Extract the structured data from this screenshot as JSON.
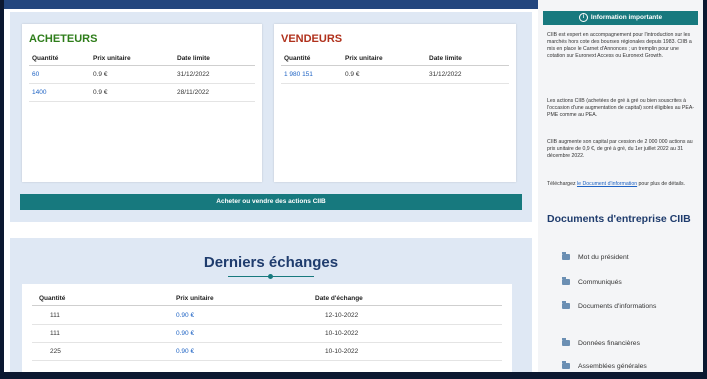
{
  "buyers": {
    "title": "ACHETEURS",
    "headers": [
      "Quantité",
      "Prix unitaire",
      "Date limite"
    ],
    "rows": [
      {
        "q": "60",
        "p": "0.9 €",
        "d": "31/12/2022"
      },
      {
        "q": "1400",
        "p": "0.9 €",
        "d": "28/11/2022"
      }
    ]
  },
  "sellers": {
    "title": "VENDEURS",
    "headers": [
      "Quantité",
      "Prix unitaire",
      "Date limite"
    ],
    "rows": [
      {
        "q": "1 980 151",
        "p": "0.9 €",
        "d": "31/12/2022"
      }
    ]
  },
  "trade_button": "Acheter ou vendre des actions CIIB",
  "exchanges": {
    "title": "Derniers échanges",
    "headers": [
      "Quantité",
      "Prix unitaire",
      "Date d'échange"
    ],
    "rows": [
      {
        "q": "111",
        "p": "0.90 €",
        "d": "12-10-2022"
      },
      {
        "q": "111",
        "p": "0.90 €",
        "d": "10-10-2022"
      },
      {
        "q": "225",
        "p": "0.90 €",
        "d": "10-10-2022"
      }
    ]
  },
  "sidebar": {
    "info_button": "Information importante",
    "p1": "CIIB est expert en accompagnement pour l'introduction sur les marchés hors cote des bourses régionales depuis 1983. CIIB a mis en place le Carnet d'Annonces ; un tremplin pour une cotation sur Euronext Access ou Euronext Growth.",
    "p2": "Les actions CIIB (achetées de gré à gré ou bien souscrites à l'occasion d'une augmentation de capital) sont éligibles au PEA-PME comme au PEA.",
    "p3": "CIIB augmente son capital par cession de 2 000 000 actions au prix unitaire de 0,9 €, de gré à gré, du 1er juillet 2022 au 31 décembre 2022.",
    "p4_prefix": "Téléchargez ",
    "p4_link": "le Document d'information",
    "p4_suffix": " pour plus de détails.",
    "docs_title": "Documents d'entreprise CIIB",
    "docs": [
      "Mot du président",
      "Communiqués",
      "Documents d'informations",
      "Données financières",
      "Assemblées générales"
    ]
  }
}
